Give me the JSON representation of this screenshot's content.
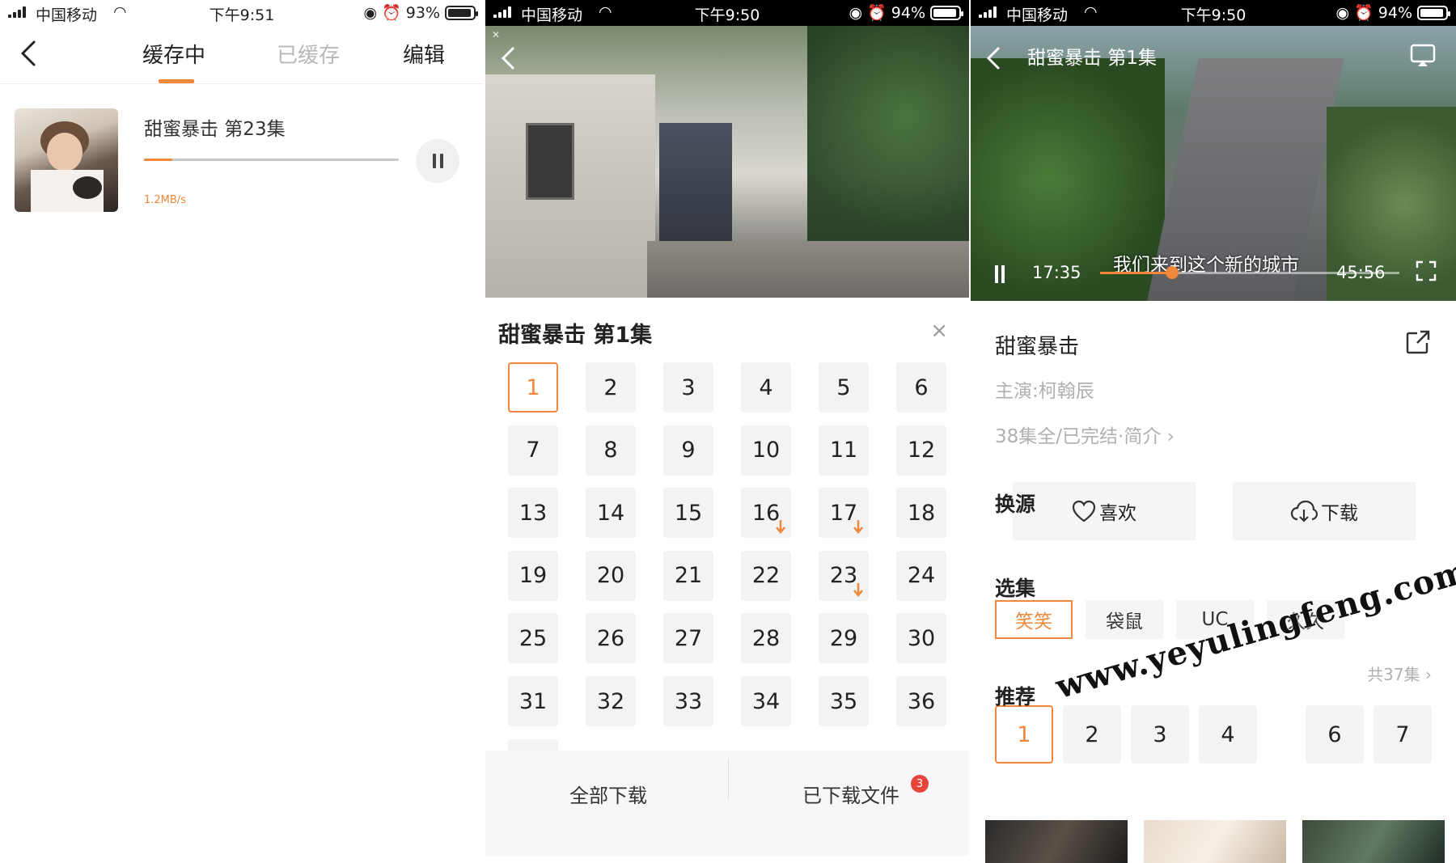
{
  "colors": {
    "accent": "#f0873a",
    "badge": "#e8443a"
  },
  "panel1": {
    "status": {
      "carrier": "中国移动",
      "time": "下午9:51",
      "battery": "93%"
    },
    "nav": {
      "tab_downloading": "缓存中",
      "tab_downloaded": "已缓存",
      "edit": "编辑"
    },
    "item": {
      "title": "甜蜜暴击 第23集",
      "speed": "1.2MB/s",
      "progress": 0.11
    }
  },
  "panel2": {
    "status": {
      "carrier": "中国移动",
      "time": "下午9:50",
      "battery": "94%"
    },
    "sheet_title": "甜蜜暴击 第1集",
    "close": "×",
    "episodes": [
      "1",
      "2",
      "3",
      "4",
      "5",
      "6",
      "7",
      "8",
      "9",
      "10",
      "11",
      "12",
      "13",
      "14",
      "15",
      "16",
      "17",
      "18",
      "19",
      "20",
      "21",
      "22",
      "23",
      "24",
      "25",
      "26",
      "27",
      "28",
      "29",
      "30",
      "31",
      "32",
      "33",
      "34",
      "35",
      "36"
    ],
    "selected": "1",
    "downloading": [
      "16",
      "17",
      "23"
    ],
    "download_all": "全部下载",
    "downloaded_files": "已下载文件",
    "badge_count": "3"
  },
  "panel3": {
    "status": {
      "carrier": "中国移动",
      "time": "下午9:50",
      "battery": "94%"
    },
    "player": {
      "title": "甜蜜暴击 第1集",
      "current": "17:35",
      "total": "45:56",
      "subtitle": "我们来到这个新的城市",
      "progress": 0.24
    },
    "show_title": "甜蜜暴击",
    "cast": "主演:柯翰辰",
    "meta": "38集全/已完结·简介 ›",
    "like": "喜欢",
    "download": "下载",
    "source_label": "换源",
    "sources": [
      "笑笑",
      "袋鼠",
      "UC",
      "久久"
    ],
    "episode_label": "选集",
    "total_eps": "共37集 ›",
    "episodes": [
      "1",
      "2",
      "3",
      "4",
      "6",
      "7"
    ],
    "recommend_label": "推荐"
  },
  "watermark": "www.yeyulingfeng.com"
}
